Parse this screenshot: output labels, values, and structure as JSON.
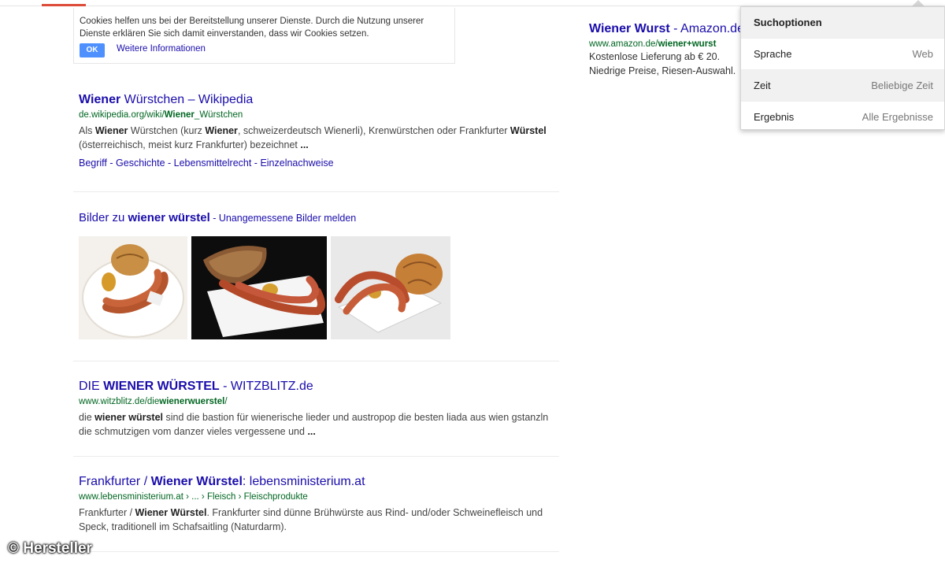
{
  "cookie_notice": {
    "text": "Cookies helfen uns bei der Bereitstellung unserer Dienste. Durch die Nutzung unserer Dienste erklären Sie sich damit einverstanden, dass wir Cookies setzen.",
    "ok_label": "OK",
    "more_info_label": "Weitere Informationen"
  },
  "results": [
    {
      "title_bold": "Wiener",
      "title_rest": " Würstchen – Wikipedia",
      "url_pre": "de.wikipedia.org/wiki/",
      "url_bold": "Wiener",
      "url_post": "_Würstchen",
      "snippet": {
        "p1": "Als ",
        "b1": "Wiener",
        "p2": " Würstchen (kurz ",
        "b2": "Wiener",
        "p3": ", schweizerdeutsch Wienerli), Krenwürstchen oder Frankfurter ",
        "b3": "Würstel",
        "p4": " (österreichisch, meist kurz Frankfurter) bezeichnet ",
        "b4": "..."
      },
      "sitelinks": [
        "Begriff",
        "Geschichte",
        "Lebensmittelrecht",
        "Einzelnachweise"
      ]
    },
    {
      "title_p1": "DIE ",
      "title_bold": "WIENER WÜRSTEL",
      "title_rest": " - WITZBLITZ.de",
      "url_pre": "www.witzblitz.de/die",
      "url_bold": "wienerwuerstel",
      "url_post": "/",
      "snippet": {
        "p1": "die ",
        "b1": "wiener würstel",
        "p2": " sind die bastion für wienerische lieder und austropop die besten liada aus wien gstanzln die schmutzigen vom danzer vieles vergessene und ",
        "b2": "..."
      }
    },
    {
      "title_p1": "Frankfurter / ",
      "title_bold": "Wiener Würstel",
      "title_rest": ": lebensministerium.at",
      "url": "www.lebensministerium.at › ... › Fleisch › Fleischprodukte",
      "snippet": {
        "p1": "Frankfurter / ",
        "b1": "Wiener Würstel",
        "p2": ". Frankfurter sind dünne Brühwürste aus Rind- und/oder Schweinefleisch und Speck, traditionell im Schafsaitling (Naturdarm)."
      }
    }
  ],
  "images_block": {
    "prefix": "Bilder zu ",
    "query_bold": "wiener würstel",
    "sep": " - ",
    "report_link": "Unangemessene Bilder melden",
    "thumbnails": [
      "sausage-plate-thumbnail",
      "sausage-bread-thumbnail",
      "sausage-roll-thumbnail"
    ]
  },
  "ad": {
    "title_bold": "Wiener Wurst",
    "title_rest": " - Amazon.de",
    "url_pre": "www.amazon.de/",
    "url_bold": "wiener+wurst",
    "line1": "Kostenlose Lieferung ab € 20.",
    "line2": "Niedrige Preise, Riesen-Auswahl."
  },
  "search_options": {
    "header": "Suchoptionen",
    "rows": [
      {
        "label": "Sprache",
        "value": "Web"
      },
      {
        "label": "Zeit",
        "value": "Beliebige Zeit"
      },
      {
        "label": "Ergebnis",
        "value": "Alle Ergebnisse"
      }
    ]
  },
  "watermark": "© Hersteller",
  "colors": {
    "link": "#1a0dab",
    "url_green": "#006621",
    "ok_button": "#4d90fe",
    "active_tab": "#dd4b39"
  }
}
